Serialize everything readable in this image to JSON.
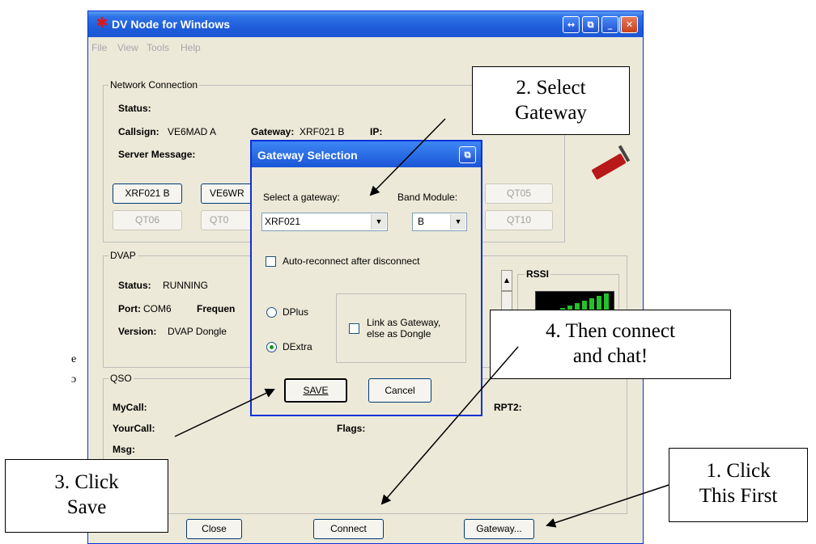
{
  "window": {
    "title": "DV Node for Windows"
  },
  "menu": [
    "File",
    "View",
    "Tools",
    "Help"
  ],
  "network": {
    "group_title": "Network Connection",
    "status_label": "Status:",
    "callsign_label": "Callsign:",
    "callsign_value": "VE6MAD A",
    "gateway_label": "Gateway:",
    "gateway_value": "XRF021 B",
    "ip_label": "IP:",
    "server_msg_label": "Server Message:",
    "buttons_row1": [
      "XRF021 B",
      "VE6WR",
      "QT05"
    ],
    "buttons_row2": [
      "QT06",
      "QT0",
      "QT10"
    ]
  },
  "dvap": {
    "group_title": "DVAP",
    "status_label": "Status:",
    "status_value": "RUNNING",
    "port_label": "Port:",
    "port_value": "COM6",
    "freq_label": "Frequen",
    "version_label": "Version:",
    "version_value": "DVAP Dongle",
    "rssi_title": "RSSI",
    "rssi_bars": 9
  },
  "qso": {
    "group_title": "QSO",
    "mycall_label": "MyCall:",
    "yourcall_label": "YourCall:",
    "msg_label": "Msg:",
    "flags_label": "Flags:",
    "rpt2_label": "RPT2:"
  },
  "bottom_buttons": {
    "close": "Close",
    "connect": "Connect",
    "gateway": "Gateway..."
  },
  "dialog": {
    "title": "Gateway Selection",
    "select_label": "Select a gateway:",
    "select_value": "XRF021",
    "band_label": "Band Module:",
    "band_value": "B",
    "autoreconnect_label": "Auto-reconnect after disconnect",
    "radio_dplus": "DPlus",
    "radio_dextra": "DExtra",
    "selected_protocol": "DExtra",
    "link_line1": "Link as Gateway,",
    "link_line2": "else as Dongle",
    "save": "SAVE",
    "cancel": "Cancel"
  },
  "callouts": {
    "step1": [
      "1. Click",
      "This First"
    ],
    "step2": [
      "2. Select",
      "Gateway"
    ],
    "step3": [
      "3. Click",
      "Save"
    ],
    "step4": [
      "4. Then connect",
      "and chat!"
    ]
  },
  "left_edge_chars": [
    "e",
    "ɔ"
  ],
  "colors": {
    "titlebar": "#1c5ad8",
    "window_bg": "#ece9d8",
    "rssi_green": "#22c32a",
    "app_icon_red": "#e01515"
  }
}
